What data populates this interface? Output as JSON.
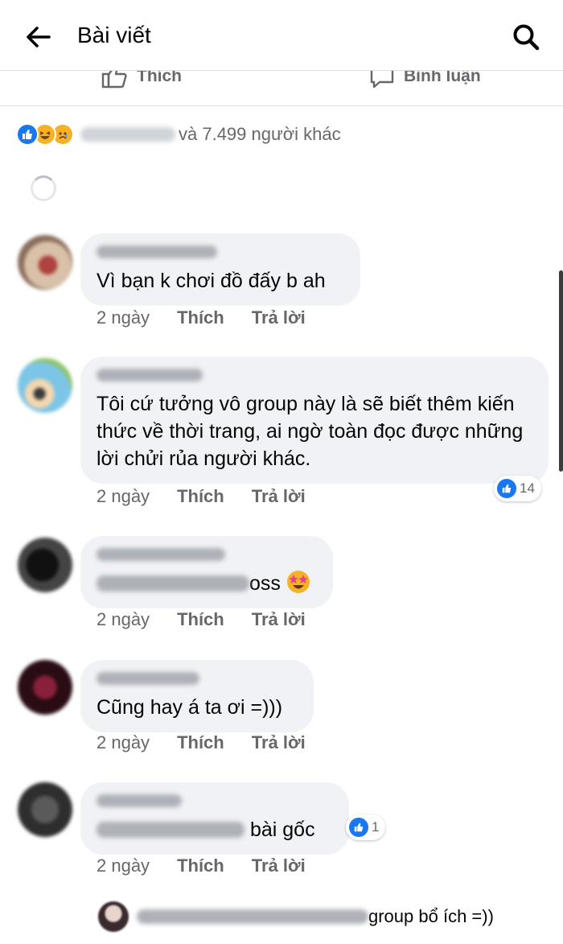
{
  "header": {
    "back_icon": "arrow-left-icon",
    "title": "Bài viết",
    "search_icon": "search-icon"
  },
  "post_actions": {
    "like_label": "Thích",
    "comment_label": "Bình luận"
  },
  "reactions": {
    "icons": [
      "like-icon",
      "haha-icon",
      "sad-icon"
    ],
    "summary_text": "và 7.499 người khác"
  },
  "comments": [
    {
      "text": "Vì bạn k chơi đồ đấy b ah",
      "time": "2 ngày",
      "like_label": "Thích",
      "reply_label": "Trả lời"
    },
    {
      "text": "Tôi cứ tưởng vô group này là sẽ biết thêm kiến thức về thời trang, ai ngờ toàn đọc được những lời chửi rủa người khác.",
      "time": "2 ngày",
      "like_label": "Thích",
      "reply_label": "Trả lời",
      "reaction_count": "14"
    },
    {
      "text": "oss",
      "emoji": "star-struck-emoji-icon",
      "time": "2 ngày",
      "like_label": "Thích",
      "reply_label": "Trả lời"
    },
    {
      "text": "Cũng hay á ta ơi =)))",
      "time": "2 ngày",
      "like_label": "Thích",
      "reply_label": "Trả lời"
    },
    {
      "text": "bài gốc",
      "time": "2 ngày",
      "like_label": "Thích",
      "reply_label": "Trả lời",
      "reaction_count": "1"
    }
  ],
  "reply_preview": {
    "text": "group bổ ích =))"
  },
  "colors": {
    "facebook_blue": "#1877f2",
    "bubble_bg": "#f0f2f5",
    "muted_text": "#65676b"
  }
}
